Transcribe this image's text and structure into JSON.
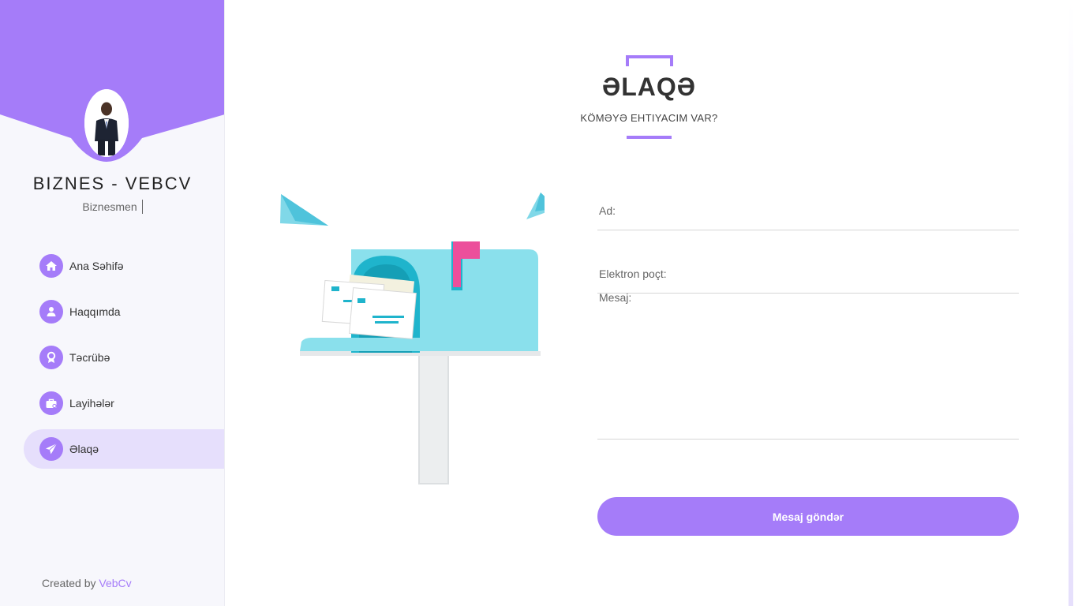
{
  "colors": {
    "accent": "#a57cf9",
    "accent_light": "#e6dffc",
    "sidebar_bg": "#f7f7fc"
  },
  "sidebar": {
    "brand_title": "BIZNES - VEBCV",
    "brand_subtitle": "Biznesmen",
    "nav": [
      {
        "label": "Ana Səhifə",
        "icon": "home-icon",
        "active": false
      },
      {
        "label": "Haqqımda",
        "icon": "user-icon",
        "active": false
      },
      {
        "label": "Təcrübə",
        "icon": "award-icon",
        "active": false
      },
      {
        "label": "Layihələr",
        "icon": "briefcase-icon",
        "active": false
      },
      {
        "label": "Əlaqə",
        "icon": "paper-plane-icon",
        "active": true
      }
    ],
    "footer_prefix": "Created by",
    "footer_link": "VebCv"
  },
  "contact": {
    "title": "ƏLAQƏ",
    "subtitle": "KÖMƏYƏ EHTIYACIM VAR?",
    "fields": {
      "name_label": "Ad:",
      "email_label": "Elektron poçt:",
      "message_label": "Mesaj:"
    },
    "submit_label": "Mesaj göndər"
  }
}
